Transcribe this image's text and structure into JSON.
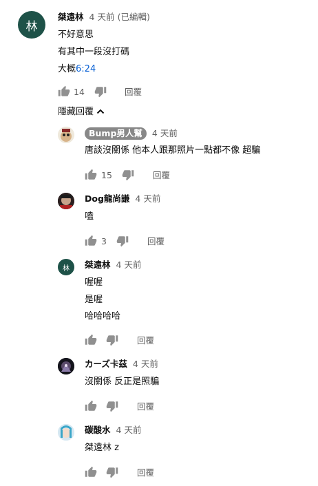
{
  "icons": {
    "like": "thumbs-up-icon",
    "dislike": "thumbs-down-icon",
    "collapse": "chevron-up-icon"
  },
  "colors": {
    "author_avatar": "#1e5248",
    "secondary_text": "#606060",
    "link": "#065fd4",
    "badge_bg": "#888888"
  },
  "top_comment": {
    "avatar_text": "林",
    "author": "桀遠林",
    "time": "4 天前",
    "edited": "(已編輯)",
    "lines": [
      "不好意思",
      "有其中一段沒打碼"
    ],
    "last_line_prefix": "大概",
    "last_line_link": "6:24",
    "like_count": "14",
    "reply_label": "回覆"
  },
  "hide_replies_label": "隱藏回覆",
  "replies": [
    {
      "author": "Bump男人幫",
      "time": "4 天前",
      "lines": [
        "唐談沒關係 他本人跟那照片一點都不像 超騙"
      ],
      "like_count": "15",
      "reply_label": "回覆"
    },
    {
      "author": "Dog龍尚謙",
      "time": "4 天前",
      "lines": [
        "嗑"
      ],
      "like_count": "3",
      "reply_label": "回覆"
    },
    {
      "avatar_text": "林",
      "author": "桀遠林",
      "time": "4 天前",
      "lines": [
        "喔喔",
        "是喔",
        "哈哈哈哈"
      ],
      "like_count": "",
      "reply_label": "回覆"
    },
    {
      "author": "カーズ卡茲",
      "time": "4 天前",
      "lines": [
        "沒關係 反正是照騙"
      ],
      "like_count": "",
      "reply_label": "回覆"
    },
    {
      "author": "碳酸水",
      "time": "4 天前",
      "lines": [
        "桀遠林 z"
      ],
      "like_count": "",
      "reply_label": "回覆"
    }
  ]
}
